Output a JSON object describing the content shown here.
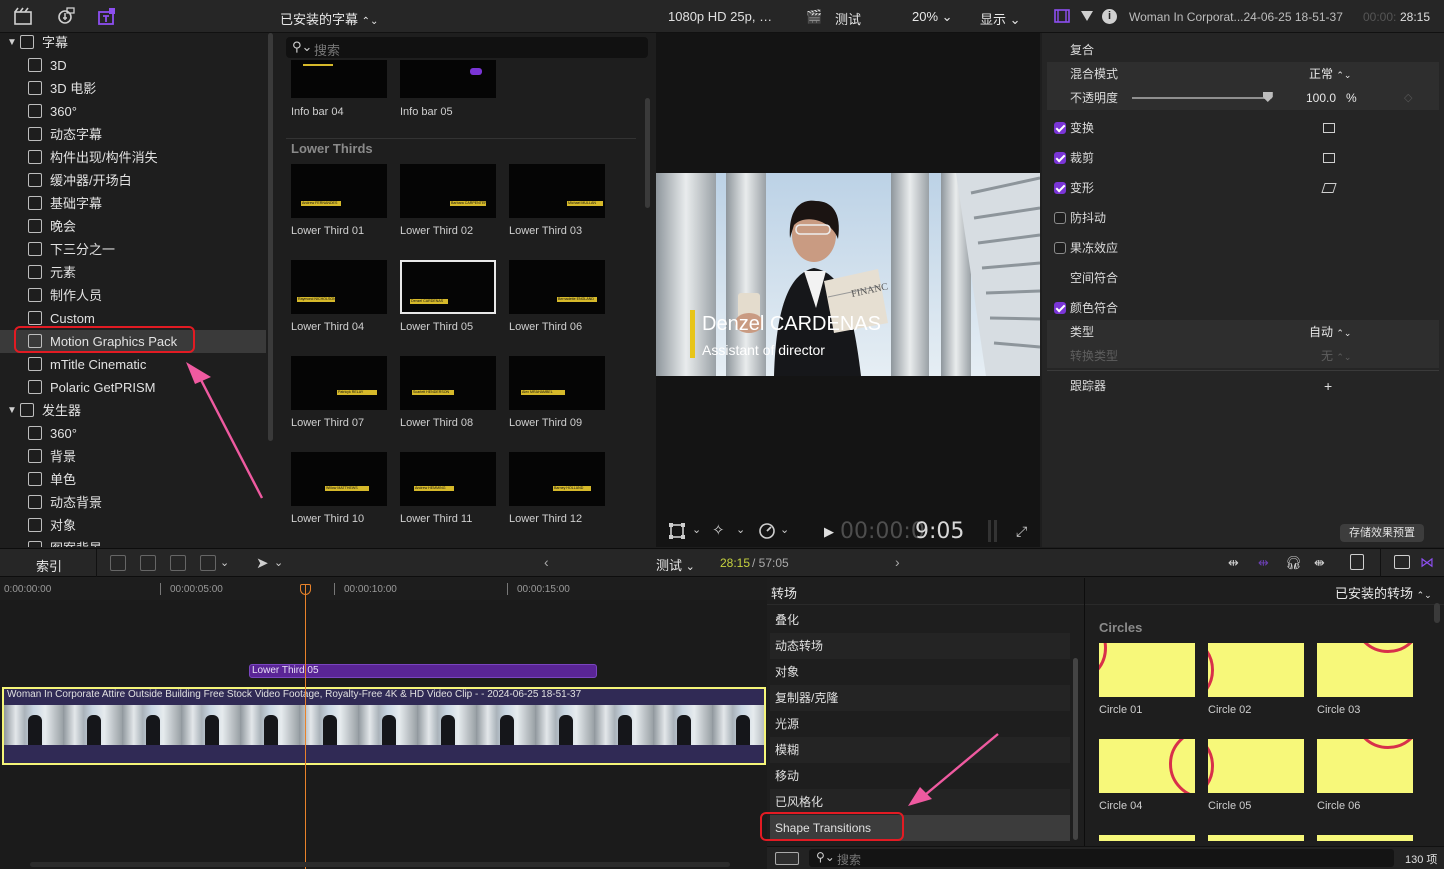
{
  "topbar": {
    "browser_title": "已安装的字幕",
    "viewer_format": "1080p HD 25p,  …",
    "viewer_project": "测试",
    "viewer_zoom": "20%",
    "viewer_display": "显示",
    "inspector_clip": "Woman In Corporat...24-06-25 18-51-37",
    "inspector_time_dim": "00:00:",
    "inspector_time": "28:15"
  },
  "sidebar": {
    "groups": [
      {
        "label": "字幕",
        "items": [
          "3D",
          "3D 电影",
          "360°",
          "动态字幕",
          "构件出现/构件消失",
          "缓冲器/开场白",
          "基础字幕",
          "晚会",
          "下三分之一",
          "元素",
          "制作人员",
          "Custom",
          "Motion Graphics Pack",
          "mTitle Cinematic",
          "Polaric GetPRISM"
        ]
      },
      {
        "label": "发生器",
        "items": [
          "360°",
          "背景",
          "单色",
          "动态背景",
          "对象",
          "图案背景"
        ]
      }
    ],
    "selected": "Motion Graphics Pack"
  },
  "browser": {
    "search_placeholder": "搜索",
    "top_items": [
      "Info bar 04",
      "Info bar 05"
    ],
    "section": "Lower Thirds",
    "items": [
      "Lower Third 01",
      "Lower Third 02",
      "Lower Third 03",
      "Lower Third 04",
      "Lower Third 05",
      "Lower Third 06",
      "Lower Third 07",
      "Lower Third 08",
      "Lower Third 09",
      "Lower Third 10",
      "Lower Third 11",
      "Lower Third 12"
    ],
    "thumb_names": [
      "Andrew FERNANDES",
      "Barbara CARPENTER",
      "Michael MULLAN",
      "Raymond NICHOLSON",
      "Denzel CARDENAS",
      "Bernadette ENGLAND",
      "Patricyk RELAY",
      "Scarlett HENDERSON",
      "Alex MRAHAMBEL",
      "Willow MATTHEWS",
      "Andrew HEMMING",
      "Barney HOLLAND"
    ]
  },
  "viewer": {
    "overlay_name": "Denzel CARDENAS",
    "overlay_title": "Assistant of director",
    "paper_text": "FINANC",
    "timecode_dim": "00:00:0",
    "timecode": "9:05"
  },
  "inspector": {
    "section": "复合",
    "blend_label": "混合模式",
    "blend_value": "正常",
    "opacity_label": "不透明度",
    "opacity_value": "100.0",
    "opacity_unit": "%",
    "opacity_level": 0.97,
    "rows": [
      {
        "label": "变换",
        "checked": true
      },
      {
        "label": "裁剪",
        "checked": true
      },
      {
        "label": "变形",
        "checked": true
      },
      {
        "label": "防抖动",
        "checked": false
      },
      {
        "label": "果冻效应",
        "checked": false
      }
    ],
    "spatial": "空间符合",
    "color": "颜色符合",
    "type_label": "类型",
    "type_value": "自动",
    "convert_label": "转换类型",
    "convert_value": "无",
    "tracker": "跟踪器",
    "save_preset": "存储效果预置"
  },
  "timeline": {
    "index_label": "索引",
    "project": "测试",
    "time_current": "28:15",
    "time_total": "/ 57:05",
    "ruler": [
      "0:00:00:00",
      "00:00:05:00",
      "00:00:10:00",
      "00:00:15:00"
    ],
    "title_clip": "Lower Third 05",
    "video_clip": "Woman In Corporate Attire Outside Building Free Stock Video Footage, Royalty-Free 4K & HD Video Clip -  - 2024-06-25 18-51-37"
  },
  "transitions": {
    "header": "转场",
    "installed": "已安装的转场",
    "categories": [
      "叠化",
      "动态转场",
      "对象",
      "复制器/克隆",
      "光源",
      "模糊",
      "移动",
      "已风格化",
      "Shape Transitions"
    ],
    "selected": "Shape Transitions",
    "section": "Circles",
    "items": [
      "Circle 01",
      "Circle 02",
      "Circle 03",
      "Circle 04",
      "Circle 05",
      "Circle 06"
    ],
    "search_placeholder": "搜索",
    "count": "130 项"
  },
  "colors": {
    "accent": "#7a35d6",
    "annotation": "#e21b23",
    "arrow": "#ef5aa0",
    "playhead": "#e8822a",
    "clip_yellow": "#f5f579"
  }
}
